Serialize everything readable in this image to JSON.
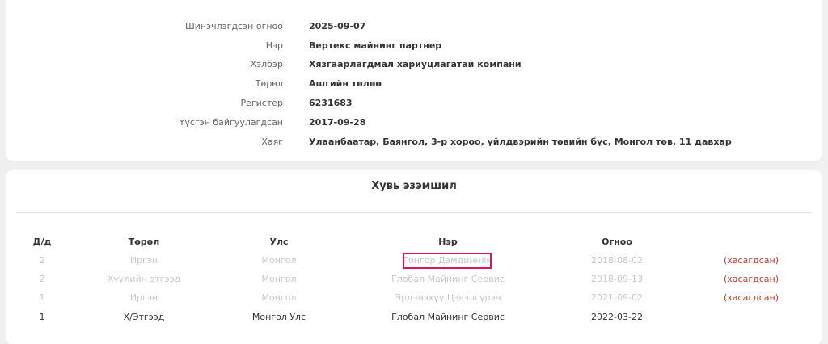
{
  "company_info": {
    "fields": [
      {
        "label": "Шинэчлэгдсэн огноо",
        "value": "2025-09-07"
      },
      {
        "label": "Нэр",
        "value": "Вертекс майнинг партнер"
      },
      {
        "label": "Хэлбэр",
        "value": "Хязгаарлагдмал хариуцлагатай компани"
      },
      {
        "label": "Төрөл",
        "value": "Ашгийн төлөө"
      },
      {
        "label": "Регистер",
        "value": "6231683"
      },
      {
        "label": "Үүсгэн байгуулагдсан",
        "value": "2017-09-28"
      },
      {
        "label": "Хаяг",
        "value": "Улаанбаатар, Баянгол, 3-р хороо, үйлдвэрийн төвийн бүс, Монгол төв, 11 давхар"
      }
    ]
  },
  "ownership": {
    "title": "Хувь эзэмшил",
    "columns": [
      "Д/д",
      "Төрөл",
      "Улс",
      "Нэр",
      "Огноо"
    ],
    "rows": [
      {
        "no": "2",
        "type": "Иргэн",
        "country": "Монгол",
        "name": "Гонгор Дамдинням",
        "date": "2018-08-02",
        "status": "(хасагдсан)",
        "deleted": true,
        "highlighted": true
      },
      {
        "no": "2",
        "type": "Хуулийн этгээд",
        "country": "Монгол",
        "name": "Глобал Майнинг Сервис",
        "date": "2018-09-13",
        "status": "(хасагдсан)",
        "deleted": true,
        "highlighted": false
      },
      {
        "no": "1",
        "type": "Иргэн",
        "country": "Монгол",
        "name": "Эрдэнэхүү Цэвэлсүрэн",
        "date": "2021-09-02",
        "status": "(хасагдсан)",
        "deleted": true,
        "highlighted": false
      },
      {
        "no": "1",
        "type": "Х/Этгээд",
        "country": "Монгол Улс",
        "name": "Глобал Майнинг Сервис",
        "date": "2022-03-22",
        "status": "",
        "deleted": false,
        "highlighted": false
      }
    ]
  },
  "colors": {
    "status_red": "#c0392b",
    "highlight_border": "#e0115f",
    "deleted_text": "#c8c8c8"
  }
}
